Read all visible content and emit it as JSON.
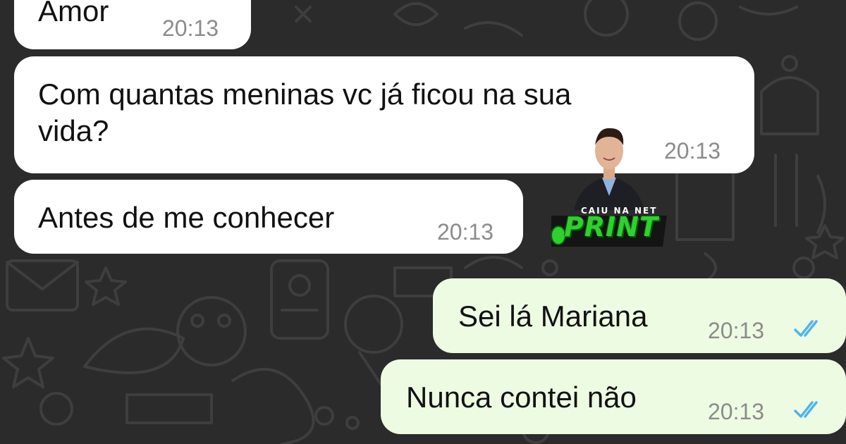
{
  "chat": {
    "messages": [
      {
        "direction": "incoming",
        "text": "Amor",
        "time": "20:13"
      },
      {
        "direction": "incoming",
        "text": "Com quantas meninas vc já ficou na sua\nvida?",
        "time": "20:13"
      },
      {
        "direction": "incoming",
        "text": "Antes de me conhecer",
        "time": "20:13"
      },
      {
        "direction": "outgoing",
        "text": "Sei lá Mariana",
        "time": "20:13",
        "read_status": "read-double-check"
      },
      {
        "direction": "outgoing",
        "text": "Nunca contei não",
        "time": "20:13",
        "read_status": "read-double-check"
      }
    ]
  },
  "watermark": {
    "tagline": "CAIU NA NET",
    "brand": "PRINT"
  },
  "colors": {
    "background": "#2b2b2b",
    "incoming_bubble": "#ffffff",
    "outgoing_bubble": "#eefbe3",
    "timestamp": "#8c8c8c",
    "read_ticks": "#4fb6ec",
    "brand_green": "#2fd02f"
  }
}
